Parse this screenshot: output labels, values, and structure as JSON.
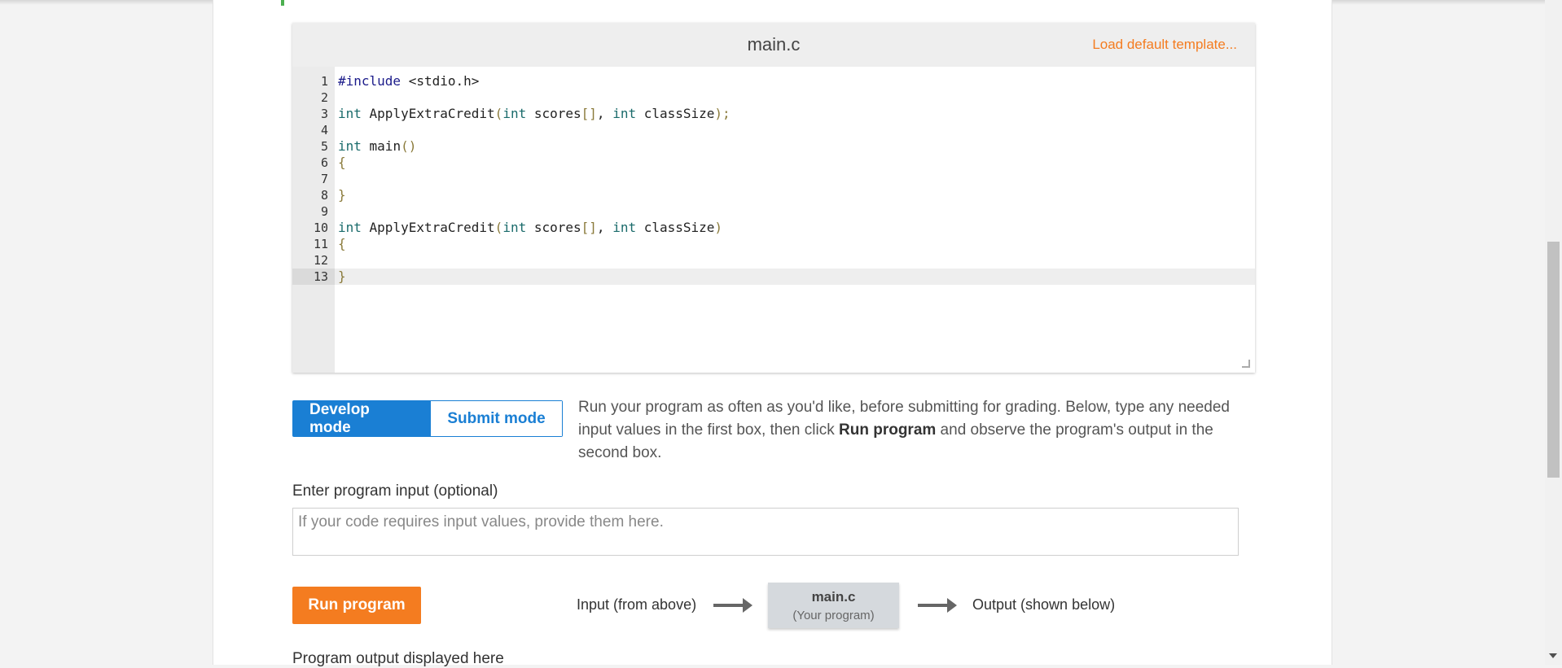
{
  "editor": {
    "filename": "main.c",
    "load_template": "Load default template...",
    "lines": [
      {
        "n": "1",
        "tokens": [
          {
            "t": "pre",
            "v": "#include"
          },
          {
            "t": "txt",
            "v": " <stdio.h>"
          }
        ]
      },
      {
        "n": "2",
        "tokens": []
      },
      {
        "n": "3",
        "tokens": [
          {
            "t": "kw",
            "v": "int"
          },
          {
            "t": "txt",
            "v": " ApplyExtraCredit"
          },
          {
            "t": "punc",
            "v": "("
          },
          {
            "t": "kw",
            "v": "int"
          },
          {
            "t": "txt",
            "v": " scores"
          },
          {
            "t": "punc",
            "v": "[]"
          },
          {
            "t": "txt",
            "v": ", "
          },
          {
            "t": "kw",
            "v": "int"
          },
          {
            "t": "txt",
            "v": " classSize"
          },
          {
            "t": "punc",
            "v": ");"
          }
        ]
      },
      {
        "n": "4",
        "tokens": []
      },
      {
        "n": "5",
        "tokens": [
          {
            "t": "kw",
            "v": "int"
          },
          {
            "t": "txt",
            "v": " main"
          },
          {
            "t": "punc",
            "v": "()"
          }
        ]
      },
      {
        "n": "6",
        "tokens": [
          {
            "t": "punc",
            "v": "{"
          }
        ]
      },
      {
        "n": "7",
        "tokens": []
      },
      {
        "n": "8",
        "tokens": [
          {
            "t": "punc",
            "v": "}"
          }
        ]
      },
      {
        "n": "9",
        "tokens": []
      },
      {
        "n": "10",
        "tokens": [
          {
            "t": "kw",
            "v": "int"
          },
          {
            "t": "txt",
            "v": " ApplyExtraCredit"
          },
          {
            "t": "punc",
            "v": "("
          },
          {
            "t": "kw",
            "v": "int"
          },
          {
            "t": "txt",
            "v": " scores"
          },
          {
            "t": "punc",
            "v": "[]"
          },
          {
            "t": "txt",
            "v": ", "
          },
          {
            "t": "kw",
            "v": "int"
          },
          {
            "t": "txt",
            "v": " classSize"
          },
          {
            "t": "punc",
            "v": ")"
          }
        ]
      },
      {
        "n": "11",
        "tokens": [
          {
            "t": "punc",
            "v": "{"
          }
        ]
      },
      {
        "n": "12",
        "tokens": []
      },
      {
        "n": "13",
        "tokens": [
          {
            "t": "punc",
            "v": "}"
          }
        ],
        "active": true
      }
    ]
  },
  "modes": {
    "develop_label": "Develop mode",
    "submit_label": "Submit mode",
    "description_1": "Run your program as often as you'd like, before submitting for grading. Below, type any needed input values in the first box, then click ",
    "description_bold": "Run program",
    "description_2": " and observe the program's output in the second box."
  },
  "input": {
    "label": "Enter program input (optional)",
    "placeholder": "If your code requires input values, provide them here.",
    "value": ""
  },
  "run": {
    "button_label": "Run program",
    "flow_input": "Input (from above)",
    "program_name": "main.c",
    "program_sub": "(Your program)",
    "flow_output": "Output (shown below)"
  },
  "output": {
    "label": "Program output displayed here"
  },
  "colors": {
    "accent_blue": "#1a7fd4",
    "accent_orange": "#f47c20"
  }
}
